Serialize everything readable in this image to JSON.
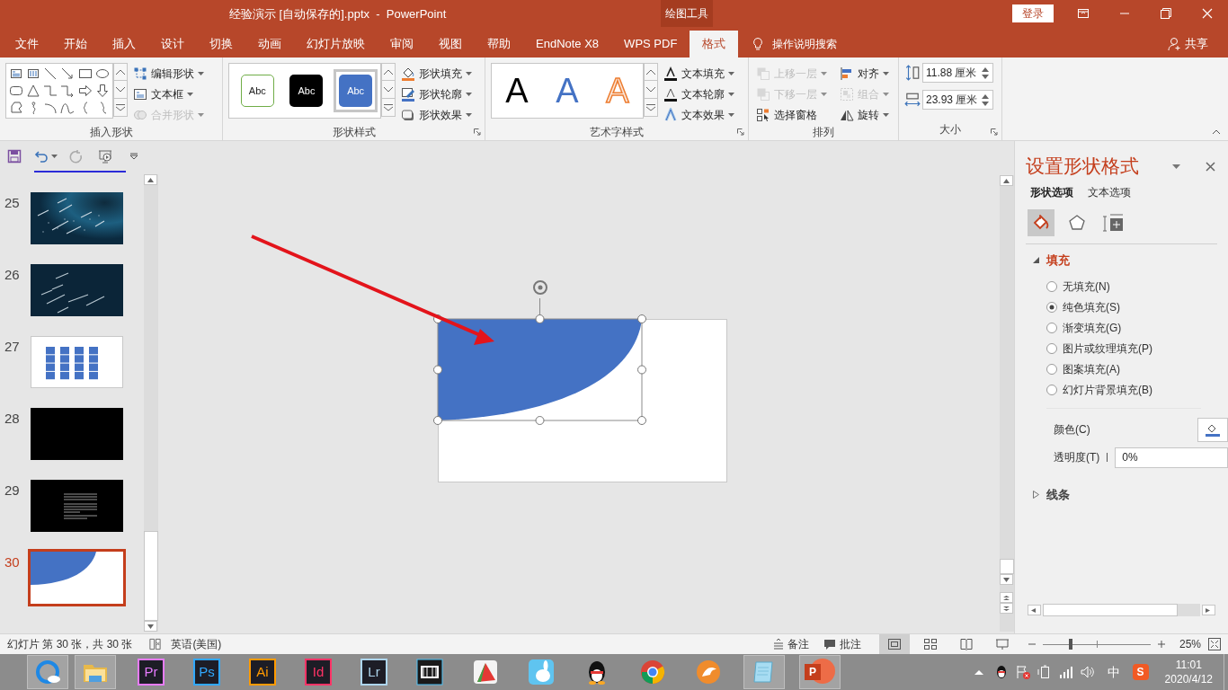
{
  "window": {
    "title": "经验演示 [自动保存的].pptx  -  PowerPoint",
    "context_label": "绘图工具",
    "login": "登录"
  },
  "tabs": [
    {
      "label": "文件",
      "selected": false
    },
    {
      "label": "开始",
      "selected": false
    },
    {
      "label": "插入",
      "selected": false
    },
    {
      "label": "设计",
      "selected": false
    },
    {
      "label": "切换",
      "selected": false
    },
    {
      "label": "动画",
      "selected": false
    },
    {
      "label": "幻灯片放映",
      "selected": false
    },
    {
      "label": "审阅",
      "selected": false
    },
    {
      "label": "视图",
      "selected": false
    },
    {
      "label": "帮助",
      "selected": false
    },
    {
      "label": "EndNote X8",
      "selected": false
    },
    {
      "label": "WPS PDF",
      "selected": false
    },
    {
      "label": "格式",
      "selected": true
    }
  ],
  "tell_me": "操作说明搜索",
  "share": "共享",
  "ribbon": {
    "insert_shapes": {
      "label": "插入形状",
      "buttons": [
        {
          "label": "编辑形状",
          "disabled": false,
          "dropdown": true
        },
        {
          "label": "文本框",
          "disabled": false,
          "dropdown": true
        },
        {
          "label": "合并形状",
          "disabled": true,
          "dropdown": true
        }
      ]
    },
    "shape_styles": {
      "label": "形状样式",
      "presets": [
        {
          "label": "Abc",
          "kind": "outline",
          "selected": false
        },
        {
          "label": "Abc",
          "kind": "dark",
          "selected": false
        },
        {
          "label": "Abc",
          "kind": "blue",
          "selected": true
        }
      ],
      "buttons": [
        {
          "label": "形状填充",
          "disabled": false,
          "dropdown": true
        },
        {
          "label": "形状轮廓",
          "disabled": false,
          "dropdown": true
        },
        {
          "label": "形状效果",
          "disabled": false,
          "dropdown": true
        }
      ]
    },
    "wordart_styles": {
      "label": "艺术字样式",
      "presets": [
        {
          "label": "A",
          "kind": "plain"
        },
        {
          "label": "A",
          "kind": "blue"
        },
        {
          "label": "A",
          "kind": "outline"
        }
      ],
      "buttons": [
        {
          "label": "文本填充",
          "disabled": false,
          "dropdown": true
        },
        {
          "label": "文本轮廓",
          "disabled": false,
          "dropdown": true
        },
        {
          "label": "文本效果",
          "disabled": false,
          "dropdown": true
        }
      ]
    },
    "arrange": {
      "label": "排列",
      "buttons": [
        {
          "label": "上移一层",
          "disabled": true,
          "dropdown": true
        },
        {
          "label": "下移一层",
          "disabled": true,
          "dropdown": true
        },
        {
          "label": "选择窗格",
          "disabled": false,
          "dropdown": false
        },
        {
          "label": "对齐",
          "disabled": false,
          "dropdown": true
        },
        {
          "label": "组合",
          "disabled": true,
          "dropdown": true
        },
        {
          "label": "旋转",
          "disabled": false,
          "dropdown": true
        }
      ]
    },
    "size": {
      "label": "大小",
      "fields": [
        {
          "kind": "height",
          "value": "11.88 厘米"
        },
        {
          "kind": "width",
          "value": "23.93 厘米"
        }
      ]
    }
  },
  "slides": [
    {
      "number": "25",
      "kind": "stars",
      "selected": false
    },
    {
      "number": "26",
      "kind": "streaks",
      "selected": false
    },
    {
      "number": "27",
      "kind": "grid",
      "selected": false
    },
    {
      "number": "28",
      "kind": "black",
      "selected": false
    },
    {
      "number": "29",
      "kind": "text",
      "selected": false
    },
    {
      "number": "30",
      "kind": "shape",
      "selected": true
    }
  ],
  "format_pane": {
    "title": "设置形状格式",
    "tabs": [
      {
        "label": "形状选项",
        "selected": true
      },
      {
        "label": "文本选项",
        "selected": false
      }
    ],
    "icon_tabs": [
      {
        "kind": "fill",
        "selected": true
      },
      {
        "kind": "effects",
        "selected": false
      },
      {
        "kind": "size",
        "selected": false
      }
    ],
    "fill_section": {
      "label": "填充",
      "expanded": true,
      "options": [
        {
          "label": "无填充(N)",
          "selected": false
        },
        {
          "label": "纯色填充(S)",
          "selected": true
        },
        {
          "label": "渐变填充(G)",
          "selected": false
        },
        {
          "label": "图片或纹理填充(P)",
          "selected": false
        },
        {
          "label": "图案填充(A)",
          "selected": false
        },
        {
          "label": "幻灯片背景填充(B)",
          "selected": false
        }
      ],
      "color_label": "颜色(C)",
      "transparency_label": "透明度(T)",
      "transparency_value": "0%"
    },
    "line_section": {
      "label": "线条",
      "expanded": false
    }
  },
  "status_bar": {
    "slide_info": "幻灯片 第 30 张，共 30 张",
    "language": "英语(美国)",
    "notes": "备注",
    "comments": "批注",
    "views": [
      {
        "kind": "normal",
        "selected": true
      },
      {
        "kind": "sorter",
        "selected": false
      },
      {
        "kind": "reading",
        "selected": false
      },
      {
        "kind": "slideshow",
        "selected": false
      }
    ],
    "zoom": {
      "level": 0.25,
      "reading": "25%"
    }
  },
  "taskbar": {
    "apps": [
      {
        "kind": "browser",
        "open": true
      },
      {
        "kind": "folder",
        "open": true
      },
      {
        "kind": "letters",
        "label": "Pr",
        "color": "#e77bff",
        "open": false
      },
      {
        "kind": "letters",
        "label": "Ps",
        "color": "#31a8ff",
        "open": false
      },
      {
        "kind": "letters",
        "label": "Ai",
        "color": "#ff9a00",
        "open": false
      },
      {
        "kind": "letters",
        "label": "Id",
        "color": "#ff3366",
        "open": false
      },
      {
        "kind": "letters",
        "label": "Lr",
        "color": "#add5ec",
        "open": false
      },
      {
        "kind": "film",
        "open": false
      },
      {
        "kind": "pie",
        "open": false
      },
      {
        "kind": "rabbit",
        "open": false
      },
      {
        "kind": "penguin",
        "open": false
      },
      {
        "kind": "chrome",
        "open": false
      },
      {
        "kind": "fox",
        "open": false
      },
      {
        "kind": "notepad",
        "open": true
      },
      {
        "kind": "powerpoint",
        "label": "P",
        "open": true
      }
    ],
    "ime": "中",
    "sogou": "S",
    "time": "11:01",
    "date": "2020/4/12"
  }
}
